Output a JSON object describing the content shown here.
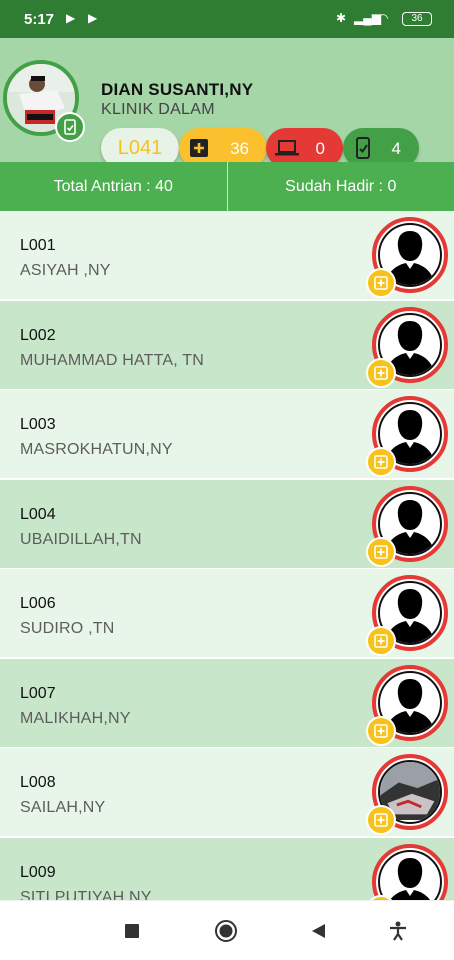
{
  "status_bar": {
    "time": "5:17",
    "battery": "36"
  },
  "doctor": {
    "name": "DIAN SUSANTI,NY",
    "clinic": "KLINIK DALAM"
  },
  "counters": {
    "queue_code": "L041",
    "plus_count": "36",
    "laptop_count": "0",
    "phone_count": "4"
  },
  "stats": {
    "total_label": "Total Antrian : 40",
    "present_label": "Sudah Hadir : 0"
  },
  "patients": [
    {
      "code": "L001",
      "name": "ASIYAH ,NY",
      "photo": "silhouette"
    },
    {
      "code": "L002",
      "name": "MUHAMMAD HATTA, TN",
      "photo": "silhouette"
    },
    {
      "code": "L003",
      "name": "MASROKHATUN,NY",
      "photo": "silhouette"
    },
    {
      "code": "L004",
      "name": "UBAIDILLAH,TN",
      "photo": "silhouette"
    },
    {
      "code": "L006",
      "name": "SUDIRO ,TN",
      "photo": "silhouette"
    },
    {
      "code": "L007",
      "name": "MALIKHAH,NY",
      "photo": "silhouette"
    },
    {
      "code": "L008",
      "name": "SAILAH,NY",
      "photo": "photo"
    },
    {
      "code": "L009",
      "name": "SITI PUTIYAH,NY",
      "photo": "silhouette"
    }
  ],
  "icons": {
    "plus": "plus-box-icon",
    "laptop": "laptop-icon",
    "phone": "phone-checkin-icon",
    "add": "add-icon",
    "nav_recent": "square-icon",
    "nav_home": "circle-icon",
    "nav_back": "triangle-back-icon",
    "nav_access": "accessibility-icon"
  },
  "colors": {
    "primary": "#4caf50",
    "dark_green": "#2e7d32",
    "yellow": "#fbc02d",
    "red": "#e53935",
    "row_light": "#e8f5e9",
    "row_dark": "#c8e6c9"
  }
}
